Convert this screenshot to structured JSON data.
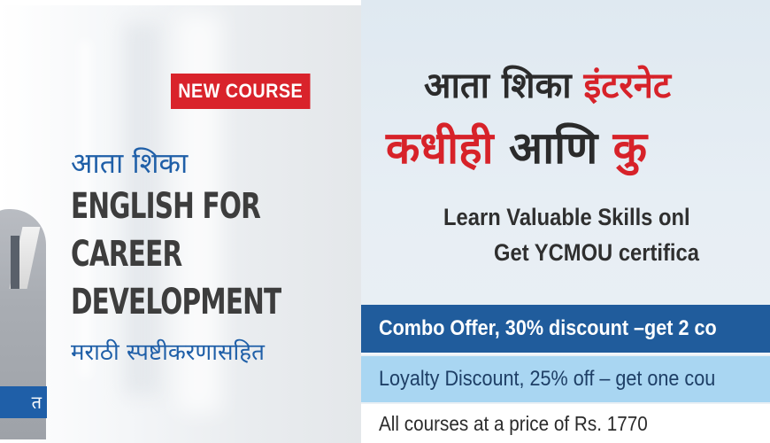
{
  "left": {
    "badge": "NEW COURSE",
    "hindi_line1": "आता शिका",
    "course_title": [
      "ENGLISH FOR",
      "CAREER",
      "DEVELOPMENT"
    ],
    "hindi_line2": "मराठी स्पष्टीकरणासहित",
    "name_strip": "त"
  },
  "right": {
    "headline1_dark": "आता शिका ",
    "headline1_red": "इंटरनेट",
    "headline2_red": "कधीही",
    "headline2_dark": " आणि ",
    "headline2_red2": "कु",
    "subtext1": "Learn Valuable Skills onl",
    "subtext2": "Get YCMOU certifica"
  },
  "offers": [
    {
      "text": "Combo Offer, 30% discount –get 2 co"
    },
    {
      "text": "Loyalty Discount, 25% off – get one cou"
    },
    {
      "text": "All courses at a price of Rs. 1770"
    }
  ],
  "colors": {
    "red": "#d72229",
    "blue": "#1f5fa8",
    "dark_blue": "#205c9c",
    "light_blue": "#a9d6f2"
  }
}
